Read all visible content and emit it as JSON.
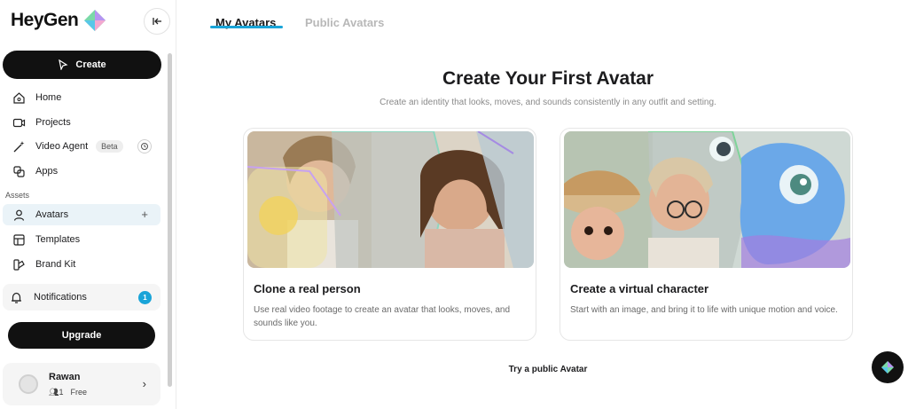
{
  "brand": {
    "name": "HeyGen",
    "accent": "#19a4d8"
  },
  "sidebar": {
    "create_label": "Create",
    "items": [
      {
        "label": "Home",
        "icon": "home-icon"
      },
      {
        "label": "Projects",
        "icon": "video-icon"
      },
      {
        "label": "Video Agent",
        "icon": "magic-wand-icon",
        "badge": "Beta"
      },
      {
        "label": "Apps",
        "icon": "apps-icon"
      }
    ],
    "assets_label": "Assets",
    "assets_items": [
      {
        "label": "Avatars",
        "icon": "person-icon",
        "active": true
      },
      {
        "label": "Templates",
        "icon": "templates-icon"
      },
      {
        "label": "Brand Kit",
        "icon": "brand-kit-icon"
      }
    ],
    "notifications": {
      "label": "Notifications",
      "count": "1"
    },
    "upgrade_label": "Upgrade",
    "user": {
      "name": "Rawan",
      "seats": "1",
      "plan": "Free"
    }
  },
  "tabs": [
    {
      "label": "My Avatars",
      "active": true
    },
    {
      "label": "Public Avatars",
      "active": false
    }
  ],
  "main": {
    "heading": "Create Your First Avatar",
    "subheading": "Create an identity that looks, moves, and sounds consistently in any outfit and setting.",
    "cards": [
      {
        "title": "Clone a real person",
        "description": "Use real video footage to create an avatar that looks, moves, and sounds like you."
      },
      {
        "title": "Create a virtual character",
        "description": "Start with an image, and bring it to life with unique motion and voice."
      }
    ],
    "try_public": "Try a public Avatar"
  }
}
